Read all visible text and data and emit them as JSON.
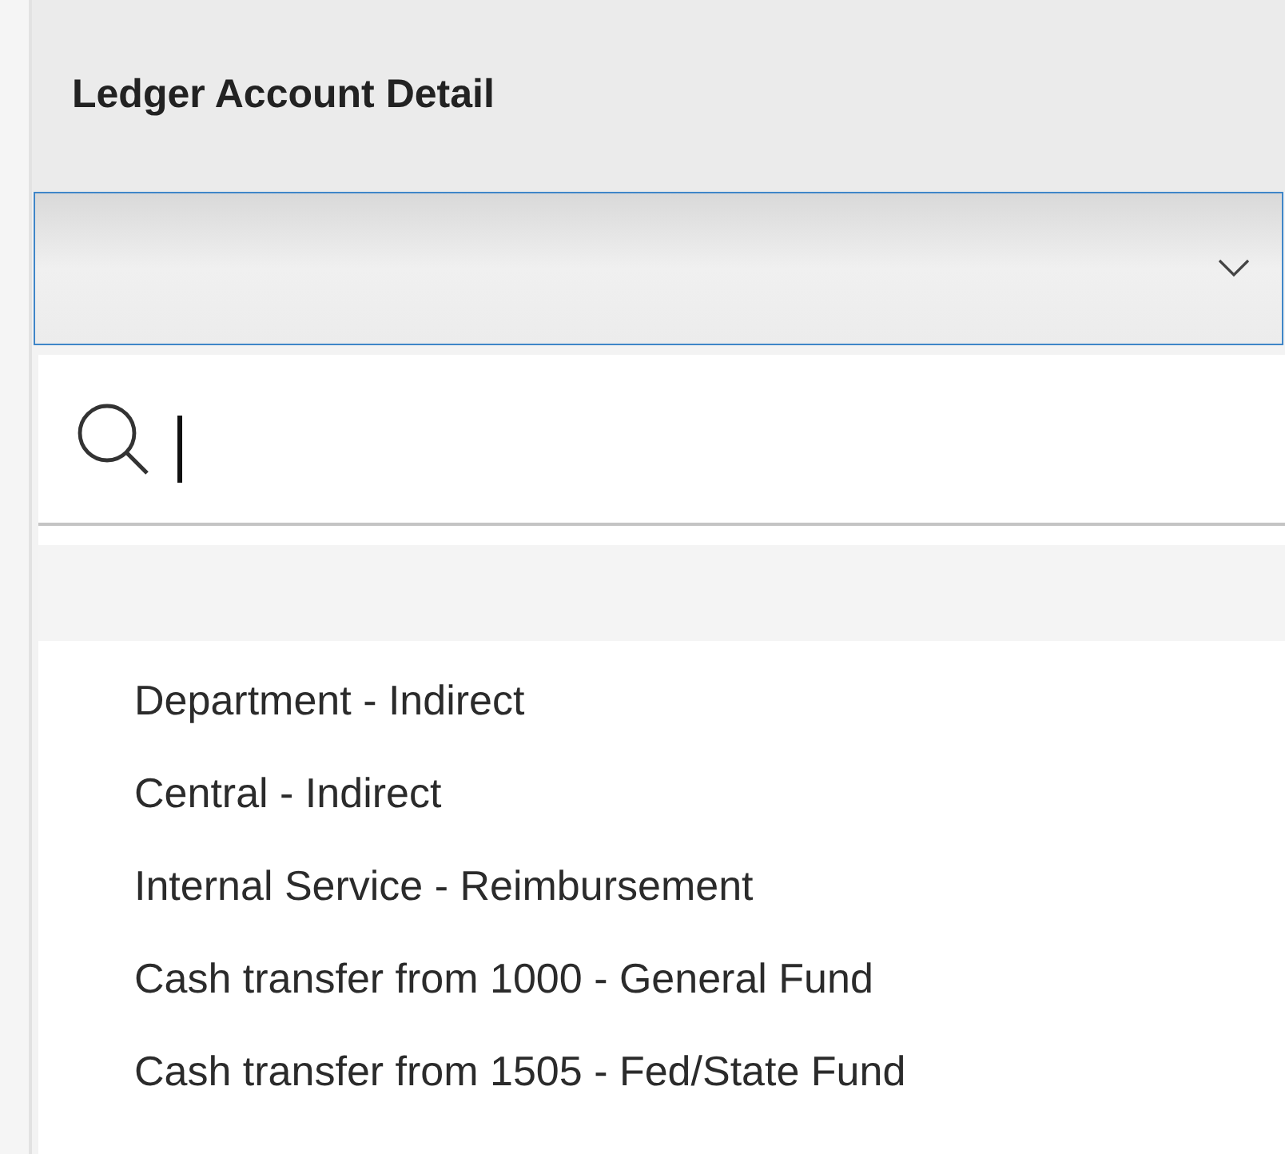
{
  "panel": {
    "title": "Ledger Account Detail"
  },
  "dropdown": {
    "expanded": true
  },
  "options": [
    {
      "label": "Department - Indirect"
    },
    {
      "label": "Central - Indirect"
    },
    {
      "label": "Internal Service - Reimbursement"
    },
    {
      "label": "Cash transfer from 1000 - General Fund"
    },
    {
      "label": "Cash transfer from 1505 - Fed/State Fund"
    }
  ]
}
